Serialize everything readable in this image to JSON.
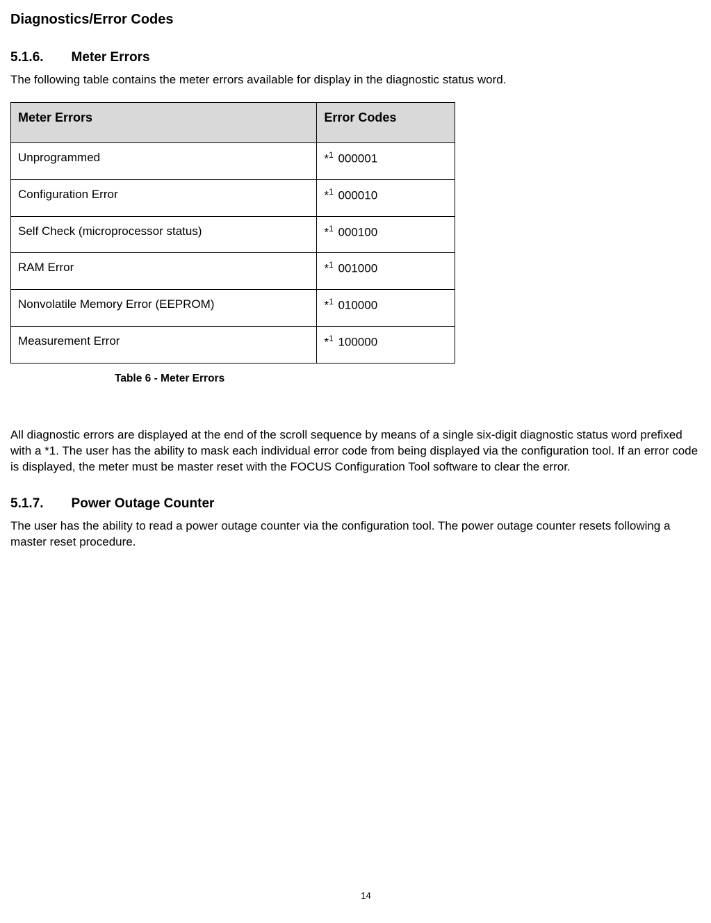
{
  "page": {
    "title": "Diagnostics/Error Codes",
    "number": "14"
  },
  "sections": {
    "meter_errors": {
      "number": "5.1.6.",
      "title": "Meter Errors",
      "intro": "The following table contains the meter errors available for display in the diagnostic status word.",
      "table": {
        "headers": {
          "col1": "Meter Errors",
          "col2": "Error Codes"
        },
        "rows": [
          {
            "name": "Unprogrammed",
            "prefix": "*",
            "sup": "1",
            "code": "000001"
          },
          {
            "name": "Configuration Error",
            "prefix": "*",
            "sup": "1",
            "code": "000010"
          },
          {
            "name": "Self Check (microprocessor status)",
            "prefix": "*",
            "sup": "1",
            "code": "000100"
          },
          {
            "name": "RAM Error",
            "prefix": "*",
            "sup": "1",
            "code": "001000"
          },
          {
            "name": "Nonvolatile Memory Error (EEPROM)",
            "prefix": "*",
            "sup": "1",
            "code": "010000"
          },
          {
            "name": "Measurement Error",
            "prefix": "*",
            "sup": "1",
            "code": "100000"
          }
        ],
        "caption": "Table 6 - Meter Errors"
      },
      "body": "All diagnostic errors are displayed at the end of the scroll sequence by means of a single six-digit diagnostic status word prefixed with a *1.  The user has the ability to mask each individual error code from being displayed via the configuration tool.  If an error code is displayed, the meter must be master reset with the FOCUS Configuration Tool software to clear the error."
    },
    "power_outage": {
      "number": "5.1.7.",
      "title": "Power Outage Counter",
      "body": "The user has the ability to read a power outage counter via the configuration tool.  The power outage counter resets following a master reset procedure."
    }
  }
}
